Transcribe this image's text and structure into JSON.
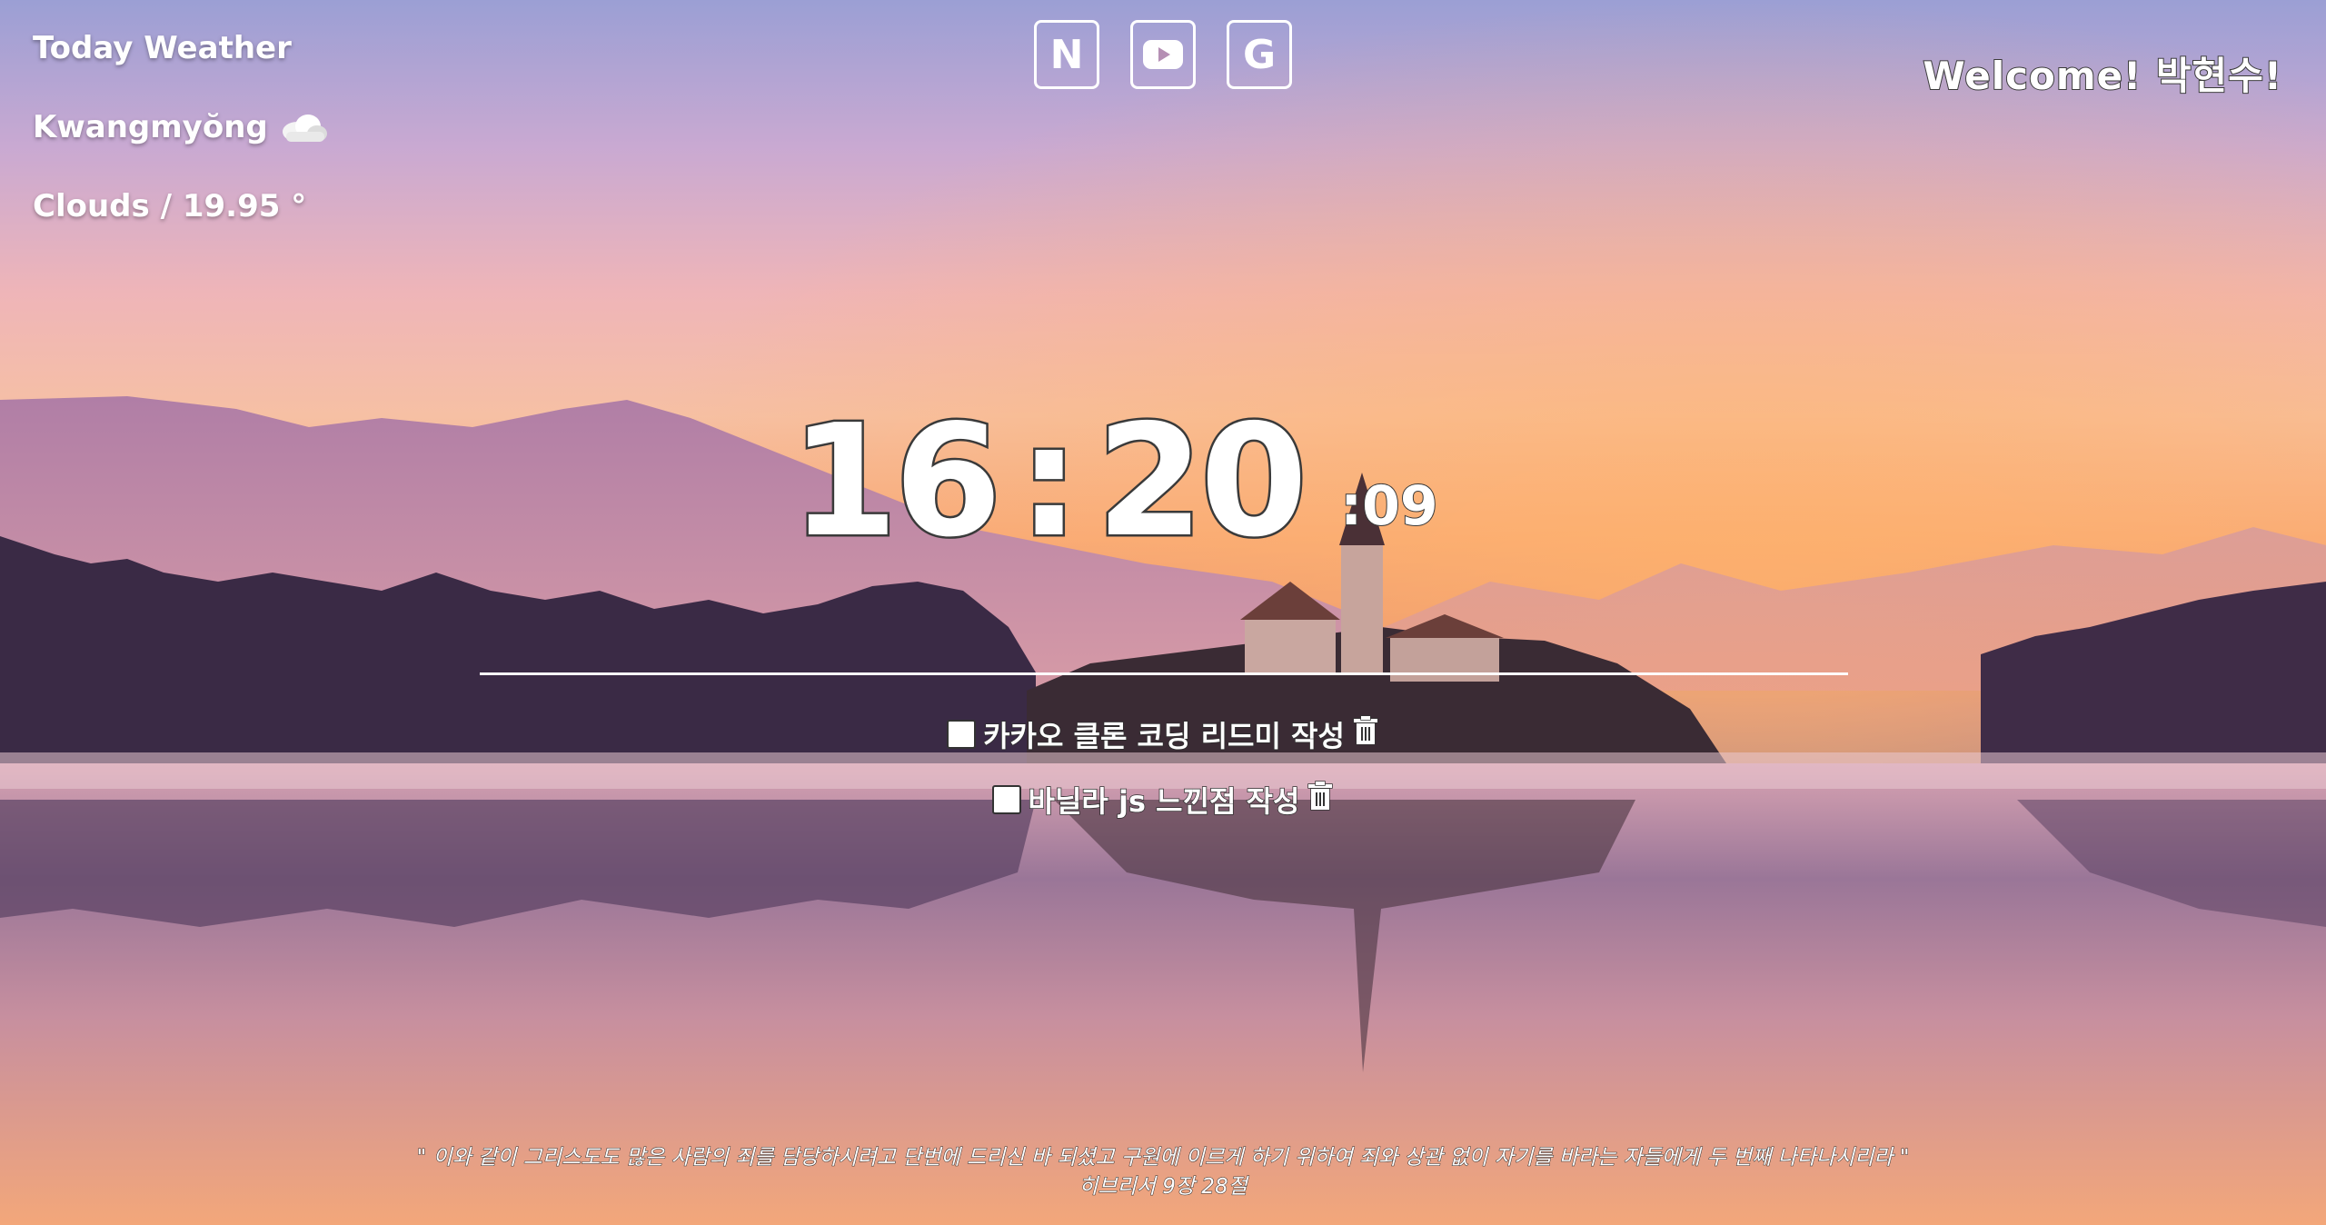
{
  "weather": {
    "title": "Today Weather",
    "city": "Kwangmyŏng",
    "city_icon": "cloud-icon",
    "description": "Clouds / 19.95 °"
  },
  "quick_links": [
    {
      "label": "N",
      "icon": "naver-icon"
    },
    {
      "label": "",
      "icon": "youtube-icon"
    },
    {
      "label": "G",
      "icon": "google-icon"
    }
  ],
  "greeting": "Welcome! 박현수!",
  "clock": {
    "hours": "16",
    "separator": ":",
    "minutes": "20",
    "seconds": ":09"
  },
  "todos": [
    {
      "text": "카카오 클론 코딩 리드미 작성",
      "checked": false
    },
    {
      "text": "바닐라 js 느낀점 작성",
      "checked": false
    }
  ],
  "quote": {
    "text": "\" 이와 같이 그리스도도 많은 사람의 죄를 담당하시려고 단번에 드리신 바 되셨고 구원에 이르게 하기 위하여 죄와 상관 없이 자기를 바라는 자들에게 두 번째 나타나시리라 \"",
    "source": "히브리서 9장 28절"
  },
  "colors": {
    "sky_top": "#9b9fd4",
    "sky_horizon": "#f7a87a",
    "mountain": "#7d5f86",
    "forest": "#3a2a45",
    "lake_glow": "#f6b185"
  }
}
